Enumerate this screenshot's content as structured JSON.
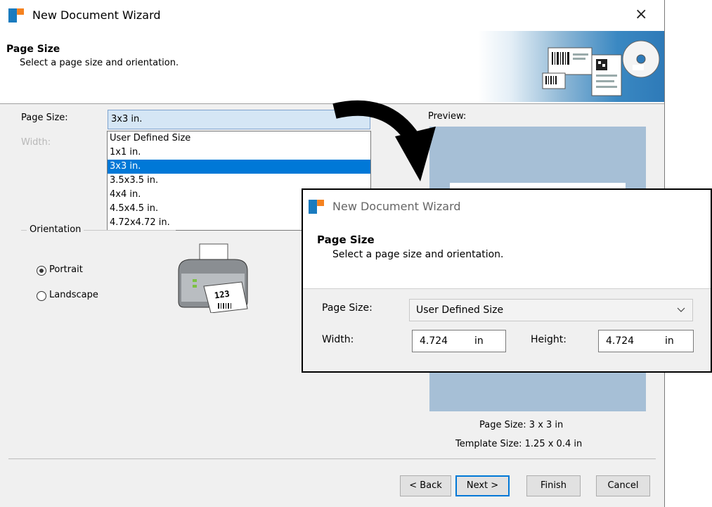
{
  "window": {
    "title": "New Document Wizard",
    "close_glyph": "×",
    "header_title": "Page Size",
    "header_subtitle": "Select a page size and orientation."
  },
  "page_size": {
    "label": "Page Size:",
    "selected": "3x3 in.",
    "options": [
      "User Defined Size",
      "1x1 in.",
      "3x3 in.",
      "3.5x3.5 in.",
      "4x4 in.",
      "4.5x4.5 in.",
      "4.72x4.72 in."
    ],
    "highlighted_index": 2
  },
  "width_label": "Width:",
  "orientation": {
    "legend": "Orientation",
    "portrait_label": "Portrait",
    "landscape_label": "Landscape",
    "selected": "Portrait",
    "printer_label": "123"
  },
  "preview": {
    "label": "Preview:",
    "page_size_text": "Page Size:  3 x 3 in",
    "template_size_text": "Template Size:  1.25 x 0.4 in"
  },
  "buttons": {
    "back": "< Back",
    "next": "Next >",
    "finish": "Finish",
    "cancel": "Cancel"
  },
  "overlay": {
    "title": "New Document Wizard",
    "header_title": "Page Size",
    "header_subtitle": "Select a page size and orientation.",
    "page_size_label": "Page Size:",
    "page_size_value": "User Defined Size",
    "width_label": "Width:",
    "width_value": "4.724",
    "width_unit": "in",
    "height_label": "Height:",
    "height_value": "4.724",
    "height_unit": "in"
  },
  "colors": {
    "accent": "#0078d7",
    "banner": "#2e7ab8",
    "preview_bg": "#a6bfd6"
  }
}
